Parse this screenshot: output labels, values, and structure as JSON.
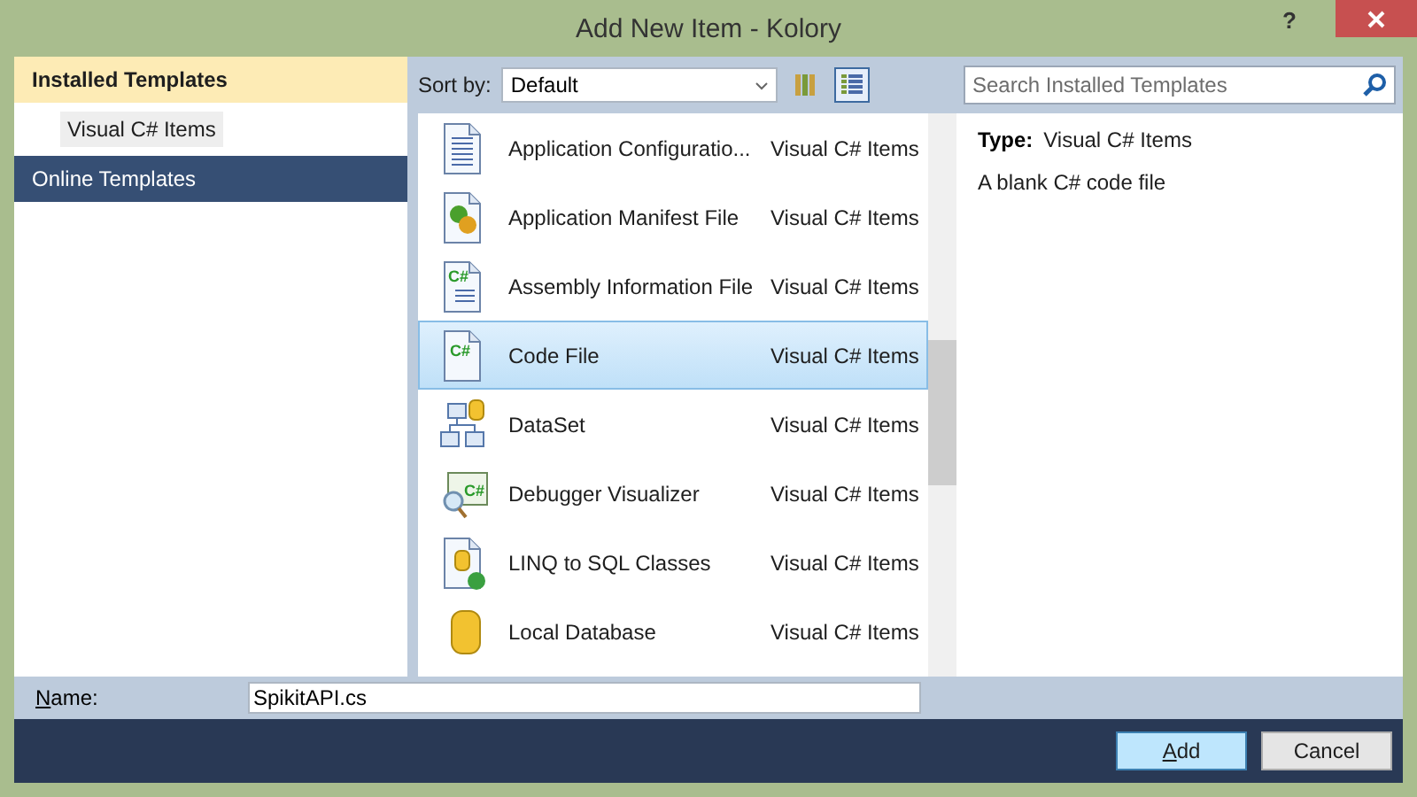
{
  "window": {
    "title": "Add New Item - Kolory",
    "help": "?"
  },
  "sidebar": {
    "items": [
      {
        "label": "Installed Templates",
        "kind": "header",
        "selected": true
      },
      {
        "label": "Visual C# Items",
        "kind": "child",
        "selected": false
      },
      {
        "label": "Online Templates",
        "kind": "header",
        "selected": false
      }
    ]
  },
  "toolbar": {
    "sort_label": "Sort by:",
    "sort_value": "Default",
    "views": [
      {
        "kind": "medium",
        "selected": false
      },
      {
        "kind": "details",
        "selected": true
      }
    ],
    "search": {
      "placeholder": "Search Installed Templates"
    }
  },
  "templates": [
    {
      "name": "Application Configuratio...",
      "type": "Visual C# Items",
      "kind": "config",
      "selected": false
    },
    {
      "name": "Application Manifest File",
      "type": "Visual C# Items",
      "kind": "manifest",
      "selected": false
    },
    {
      "name": "Assembly Information File",
      "type": "Visual C# Items",
      "kind": "assembly",
      "icon_text": "C#",
      "selected": false
    },
    {
      "name": "Code File",
      "type": "Visual C# Items",
      "kind": "code",
      "icon_text": "C#",
      "selected": true
    },
    {
      "name": "DataSet",
      "type": "Visual C# Items",
      "kind": "dataset",
      "selected": false
    },
    {
      "name": "Debugger Visualizer",
      "type": "Visual C# Items",
      "kind": "debugger",
      "icon_text": "C#",
      "selected": false
    },
    {
      "name": "LINQ to SQL Classes",
      "type": "Visual C# Items",
      "kind": "linq",
      "selected": false
    },
    {
      "name": "Local Database",
      "type": "Visual C# Items",
      "kind": "database",
      "selected": false
    }
  ],
  "details": {
    "type_label": "Type:",
    "type_value": "Visual C# Items",
    "description": "A blank C# code file"
  },
  "name_field": {
    "label": "Name:",
    "value": "SpikitAPI.cs"
  },
  "buttons": [
    {
      "label": "Add",
      "default": true
    },
    {
      "label": "Cancel",
      "default": false
    }
  ]
}
